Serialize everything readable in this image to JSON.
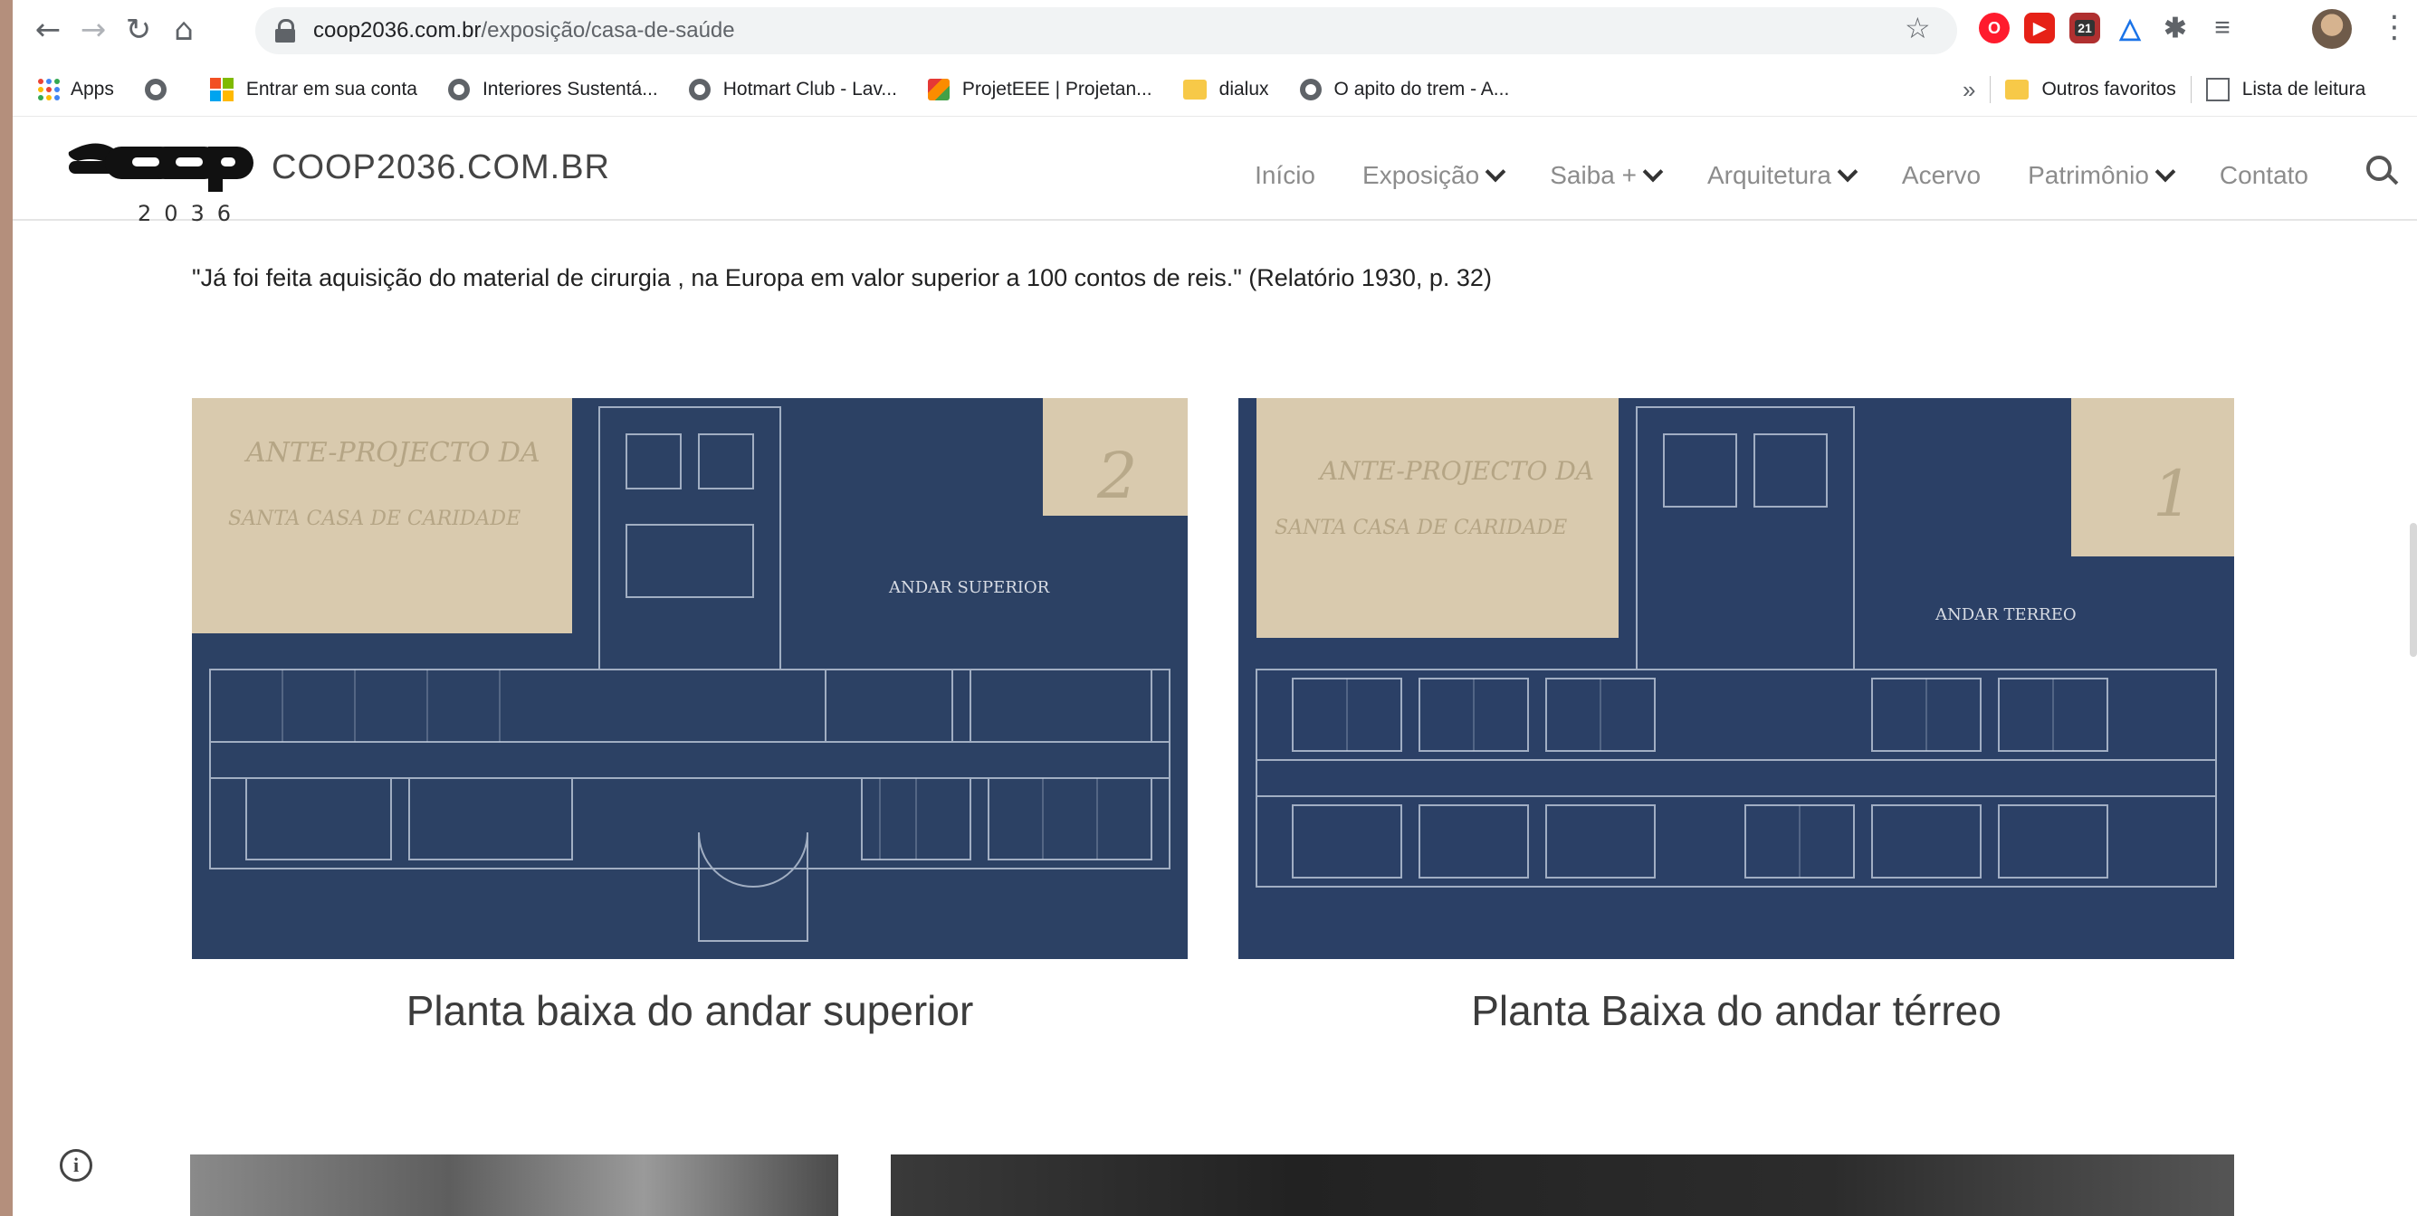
{
  "browser": {
    "url_host": "coop2036.com.br",
    "url_path": "/exposição/casa-de-saúde",
    "extension_badge": "21"
  },
  "bookmarks": {
    "items": [
      {
        "label": "Apps"
      },
      {
        "label": ""
      },
      {
        "label": "Entrar em sua conta"
      },
      {
        "label": "Interiores Sustentá..."
      },
      {
        "label": "Hotmart Club - Lav..."
      },
      {
        "label": "ProjetEEE | Projetan..."
      },
      {
        "label": "dialux"
      },
      {
        "label": "O apito do trem - A..."
      }
    ],
    "overflow": "»",
    "other_favorites": "Outros favoritos",
    "reading_list": "Lista de leitura"
  },
  "site": {
    "logo_text": "coop",
    "logo_number": "2036",
    "title": "COOP2036.COM.BR",
    "menu": [
      {
        "label": "Início",
        "dropdown": false
      },
      {
        "label": "Exposição",
        "dropdown": true
      },
      {
        "label": "Saiba +",
        "dropdown": true
      },
      {
        "label": "Arquitetura",
        "dropdown": true
      },
      {
        "label": "Acervo",
        "dropdown": false
      },
      {
        "label": "Patrimônio",
        "dropdown": true
      },
      {
        "label": "Contato",
        "dropdown": false
      }
    ]
  },
  "content": {
    "quote": "\"Já foi feita aquisição do material de cirurgia , na Europa em valor superior a 100 contos de reis.\" (Relatório 1930, p. 32)",
    "figures": [
      {
        "caption": "Planta baixa do andar superior",
        "label_line1": "ANTE-PROJECTO DA",
        "label_line2": "SANTA CASA DE CARIDADE",
        "floor_label": "ANDAR SUPERIOR",
        "sheet_number": "2"
      },
      {
        "caption": "Planta Baixa do andar térreo",
        "label_line1": "ANTE-PROJECTO DA",
        "label_line2": "SANTA CASA DE CARIDADE",
        "floor_label": "ANDAR TERREO",
        "sheet_number": "1"
      }
    ]
  },
  "colors": {
    "blueprint": "#2b3f63",
    "paper": "#e7d5b5",
    "menu_text": "#8c8c8c"
  }
}
